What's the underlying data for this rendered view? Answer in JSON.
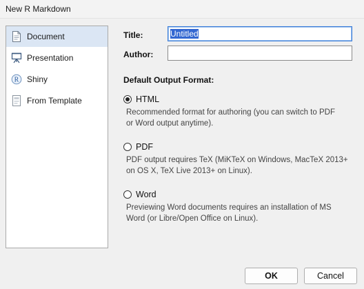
{
  "window": {
    "title": "New R Markdown"
  },
  "sidebar": {
    "items": [
      {
        "label": "Document",
        "icon": "document-icon",
        "selected": true
      },
      {
        "label": "Presentation",
        "icon": "presentation-icon",
        "selected": false
      },
      {
        "label": "Shiny",
        "icon": "shiny-r-icon",
        "selected": false
      },
      {
        "label": "From Template",
        "icon": "template-icon",
        "selected": false
      }
    ]
  },
  "form": {
    "title_label": "Title:",
    "title_value": "Untitled",
    "author_label": "Author:",
    "author_value": ""
  },
  "output": {
    "section_label": "Default Output Format:",
    "options": [
      {
        "label": "HTML",
        "checked": true,
        "desc_line1": "Recommended format for authoring (you can switch to PDF",
        "desc_line2": "or Word output anytime)."
      },
      {
        "label": "PDF",
        "checked": false,
        "desc_line1": "PDF output requires TeX (MiKTeX on Windows, MacTeX 2013+",
        "desc_line2": "on OS X, TeX Live 2013+ on Linux)."
      },
      {
        "label": "Word",
        "checked": false,
        "desc_line1": "Previewing Word documents requires an installation of MS",
        "desc_line2": "Word (or Libre/Open Office on Linux)."
      }
    ]
  },
  "buttons": {
    "ok": "OK",
    "cancel": "Cancel"
  },
  "colors": {
    "selection": "#dbe6f4",
    "focus": "#3b7dd8",
    "text_selection": "#3a78d6"
  }
}
